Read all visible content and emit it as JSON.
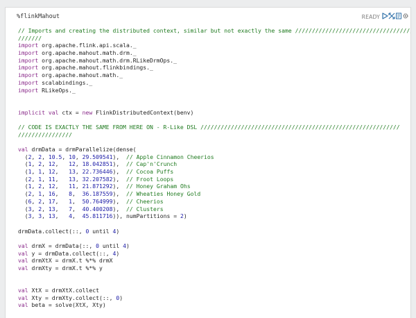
{
  "paragraph": {
    "title": "%flinkMahout",
    "status": "READY",
    "icons": [
      "run-icon",
      "collapse-icon",
      "book-icon",
      "gear-icon"
    ]
  },
  "colors": {
    "comment": "#1f7a1f",
    "keyword": "#8a2a8a",
    "number": "#1a1aa6",
    "accent": "#3071a9"
  },
  "code": {
    "lines": [
      [
        [
          "cm",
          "// Imports and creating the distributed context, similar but not exactly the same ////////////////////////////////////"
        ]
      ],
      [
        [
          "cm",
          "///////"
        ]
      ],
      [
        [
          "kw",
          "import"
        ],
        [
          "plain",
          " org.apache.flink.api.scala._"
        ]
      ],
      [
        [
          "kw",
          "import"
        ],
        [
          "plain",
          " org.apache.mahout.math.drm._"
        ]
      ],
      [
        [
          "kw",
          "import"
        ],
        [
          "plain",
          " org.apache.mahout.math.drm.RLikeDrmOps._"
        ]
      ],
      [
        [
          "kw",
          "import"
        ],
        [
          "plain",
          " org.apache.mahout.flinkbindings._"
        ]
      ],
      [
        [
          "kw",
          "import"
        ],
        [
          "plain",
          " org.apache.mahout.math._"
        ]
      ],
      [
        [
          "kw",
          "import"
        ],
        [
          "plain",
          " scalabindings._"
        ]
      ],
      [
        [
          "kw",
          "import"
        ],
        [
          "plain",
          " RLikeOps._"
        ]
      ],
      [],
      [],
      [
        [
          "kw",
          "implicit val"
        ],
        [
          "plain",
          " ctx = "
        ],
        [
          "kw",
          "new"
        ],
        [
          "plain",
          " FlinkDistributedContext(benv)"
        ]
      ],
      [],
      [
        [
          "cm",
          "// CODE IS EXACTLY THE SAME FROM HERE ON - R-Like DSL ///////////////////////////////////////////////////////////"
        ]
      ],
      [
        [
          "cm",
          "////////////////"
        ]
      ],
      [],
      [
        [
          "kw",
          "val"
        ],
        [
          "plain",
          " drmData = drmParallelize(dense("
        ]
      ],
      [
        [
          "plain",
          "  ("
        ],
        [
          "num",
          "2"
        ],
        [
          "plain",
          ", "
        ],
        [
          "num",
          "2"
        ],
        [
          "plain",
          ", "
        ],
        [
          "num",
          "10.5"
        ],
        [
          "plain",
          ", "
        ],
        [
          "num",
          "10"
        ],
        [
          "plain",
          ", "
        ],
        [
          "num",
          "29.509541"
        ],
        [
          "plain",
          "),  "
        ],
        [
          "cm",
          "// Apple Cinnamon Cheerios"
        ]
      ],
      [
        [
          "plain",
          "  ("
        ],
        [
          "num",
          "1"
        ],
        [
          "plain",
          ", "
        ],
        [
          "num",
          "2"
        ],
        [
          "plain",
          ", "
        ],
        [
          "num",
          "12"
        ],
        [
          "plain",
          ",   "
        ],
        [
          "num",
          "12"
        ],
        [
          "plain",
          ", "
        ],
        [
          "num",
          "18.042851"
        ],
        [
          "plain",
          "),  "
        ],
        [
          "cm",
          "// Cap'n'Crunch"
        ]
      ],
      [
        [
          "plain",
          "  ("
        ],
        [
          "num",
          "1"
        ],
        [
          "plain",
          ", "
        ],
        [
          "num",
          "1"
        ],
        [
          "plain",
          ", "
        ],
        [
          "num",
          "12"
        ],
        [
          "plain",
          ",   "
        ],
        [
          "num",
          "13"
        ],
        [
          "plain",
          ", "
        ],
        [
          "num",
          "22.736446"
        ],
        [
          "plain",
          "),  "
        ],
        [
          "cm",
          "// Cocoa Puffs"
        ]
      ],
      [
        [
          "plain",
          "  ("
        ],
        [
          "num",
          "2"
        ],
        [
          "plain",
          ", "
        ],
        [
          "num",
          "1"
        ],
        [
          "plain",
          ", "
        ],
        [
          "num",
          "11"
        ],
        [
          "plain",
          ",   "
        ],
        [
          "num",
          "13"
        ],
        [
          "plain",
          ", "
        ],
        [
          "num",
          "32.207582"
        ],
        [
          "plain",
          "),  "
        ],
        [
          "cm",
          "// Froot Loops"
        ]
      ],
      [
        [
          "plain",
          "  ("
        ],
        [
          "num",
          "1"
        ],
        [
          "plain",
          ", "
        ],
        [
          "num",
          "2"
        ],
        [
          "plain",
          ", "
        ],
        [
          "num",
          "12"
        ],
        [
          "plain",
          ",   "
        ],
        [
          "num",
          "11"
        ],
        [
          "plain",
          ", "
        ],
        [
          "num",
          "21.871292"
        ],
        [
          "plain",
          "),  "
        ],
        [
          "cm",
          "// Honey Graham Ohs"
        ]
      ],
      [
        [
          "plain",
          "  ("
        ],
        [
          "num",
          "2"
        ],
        [
          "plain",
          ", "
        ],
        [
          "num",
          "1"
        ],
        [
          "plain",
          ", "
        ],
        [
          "num",
          "16"
        ],
        [
          "plain",
          ",   "
        ],
        [
          "num",
          "8"
        ],
        [
          "plain",
          ",  "
        ],
        [
          "num",
          "36.187559"
        ],
        [
          "plain",
          "),  "
        ],
        [
          "cm",
          "// Wheaties Honey Gold"
        ]
      ],
      [
        [
          "plain",
          "  ("
        ],
        [
          "num",
          "6"
        ],
        [
          "plain",
          ", "
        ],
        [
          "num",
          "2"
        ],
        [
          "plain",
          ", "
        ],
        [
          "num",
          "17"
        ],
        [
          "plain",
          ",   "
        ],
        [
          "num",
          "1"
        ],
        [
          "plain",
          ",  "
        ],
        [
          "num",
          "50.764999"
        ],
        [
          "plain",
          "),  "
        ],
        [
          "cm",
          "// Cheerios"
        ]
      ],
      [
        [
          "plain",
          "  ("
        ],
        [
          "num",
          "3"
        ],
        [
          "plain",
          ", "
        ],
        [
          "num",
          "2"
        ],
        [
          "plain",
          ", "
        ],
        [
          "num",
          "13"
        ],
        [
          "plain",
          ",   "
        ],
        [
          "num",
          "7"
        ],
        [
          "plain",
          ",  "
        ],
        [
          "num",
          "40.400208"
        ],
        [
          "plain",
          "),  "
        ],
        [
          "cm",
          "// Clusters"
        ]
      ],
      [
        [
          "plain",
          "  ("
        ],
        [
          "num",
          "3"
        ],
        [
          "plain",
          ", "
        ],
        [
          "num",
          "3"
        ],
        [
          "plain",
          ", "
        ],
        [
          "num",
          "13"
        ],
        [
          "plain",
          ",   "
        ],
        [
          "num",
          "4"
        ],
        [
          "plain",
          ",  "
        ],
        [
          "num",
          "45.811716"
        ],
        [
          "plain",
          ")), numPartitions = "
        ],
        [
          "num",
          "2"
        ],
        [
          "plain",
          ")"
        ]
      ],
      [],
      [
        [
          "plain",
          "drmData.collect(::, "
        ],
        [
          "num",
          "0"
        ],
        [
          "plain",
          " until "
        ],
        [
          "num",
          "4"
        ],
        [
          "plain",
          ")"
        ]
      ],
      [],
      [
        [
          "kw",
          "val"
        ],
        [
          "plain",
          " drmX = drmData(::, "
        ],
        [
          "num",
          "0"
        ],
        [
          "plain",
          " until "
        ],
        [
          "num",
          "4"
        ],
        [
          "plain",
          ")"
        ]
      ],
      [
        [
          "kw",
          "val"
        ],
        [
          "plain",
          " y = drmData.collect(::, "
        ],
        [
          "num",
          "4"
        ],
        [
          "plain",
          ")"
        ]
      ],
      [
        [
          "kw",
          "val"
        ],
        [
          "plain",
          " drmXtX = drmX.t %*% drmX"
        ]
      ],
      [
        [
          "kw",
          "val"
        ],
        [
          "plain",
          " drmXty = drmX.t %*% y"
        ]
      ],
      [],
      [],
      [
        [
          "kw",
          "val"
        ],
        [
          "plain",
          " XtX = drmXtX.collect"
        ]
      ],
      [
        [
          "kw",
          "val"
        ],
        [
          "plain",
          " Xty = drmXty.collect(::, "
        ],
        [
          "num",
          "0"
        ],
        [
          "plain",
          ")"
        ]
      ],
      [
        [
          "kw",
          "val"
        ],
        [
          "plain",
          " beta = solve(XtX, Xty)"
        ]
      ]
    ]
  }
}
